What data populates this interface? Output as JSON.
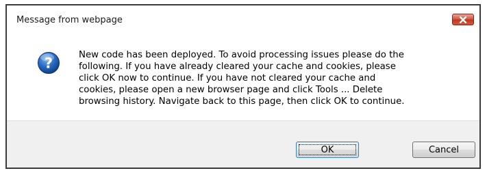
{
  "dialog": {
    "title": "Message from webpage",
    "close_icon": "close-icon",
    "icon": "question-icon",
    "message": "New code has been deployed. To avoid processing issues please do the\nfollowing. If you have already cleared your cache and cookies, please\nclick OK now to continue. If you have not cleared your cache and\ncookies, please open a new browser page and click Tools ... Delete\nbrowsing history. Navigate back to this page, then click OK to continue.",
    "ok_label": "OK",
    "cancel_label": "Cancel"
  },
  "colors": {
    "close_button": "#c7452c",
    "question_icon": "#1f5fb0",
    "footer_background": "#f0f0f0"
  }
}
